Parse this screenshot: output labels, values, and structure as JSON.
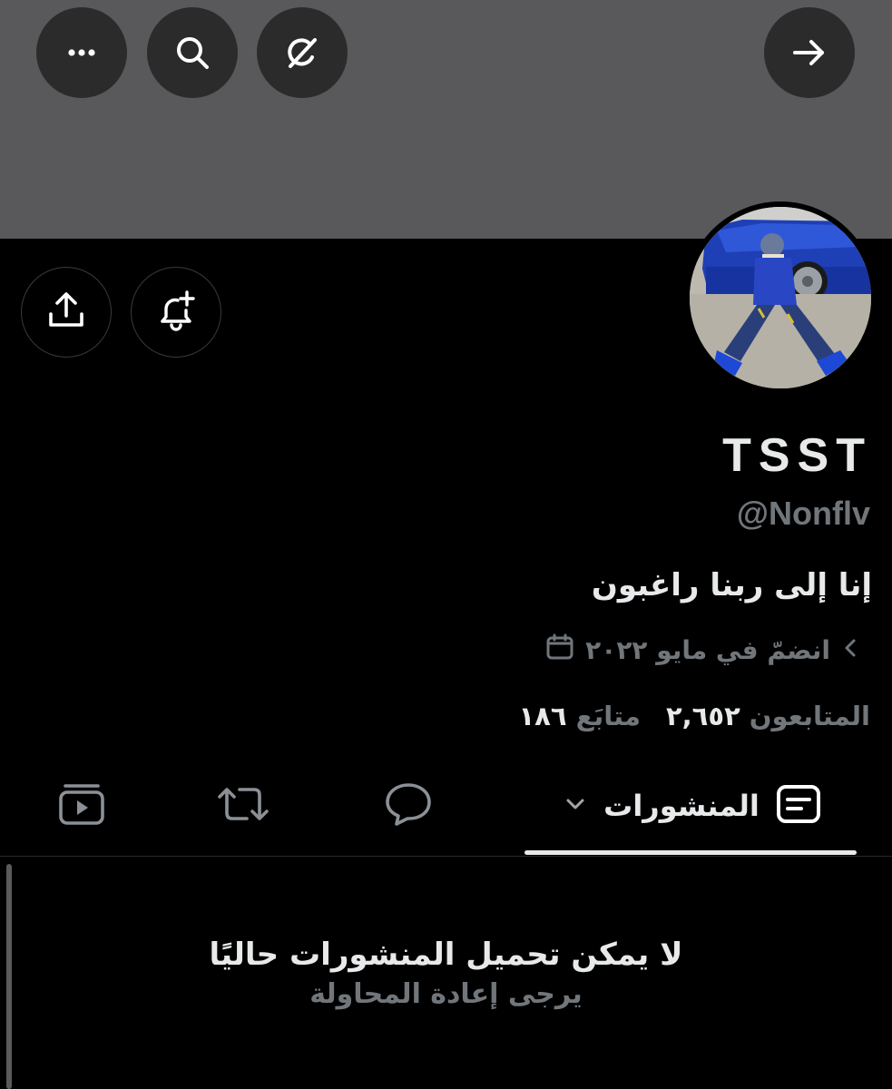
{
  "header": {
    "back_icon": "arrow-right-icon",
    "grok_icon": "grok-icon",
    "search_icon": "search-icon",
    "more_icon": "more-icon"
  },
  "profile": {
    "display_name": "TSST",
    "handle": "@Nonflv",
    "bio": "إنا إلى ربنا راغبون",
    "joined": "انضمّ في مايو ٢٠٢٢",
    "following_count": "١٨٦",
    "following_label": "متابَع",
    "followers_count": "٢,٦٥٢",
    "followers_label": "المتابعون"
  },
  "tabs": {
    "posts_label": "المنشورات",
    "active": "posts"
  },
  "empty_state": {
    "title": "لا يمكن تحميل المنشورات حاليًا",
    "subtitle": "يرجى إعادة المحاولة"
  },
  "colors": {
    "background": "#000000",
    "banner": "#59595b",
    "primary_text": "#e7e9ea",
    "secondary_text": "#71767b"
  }
}
